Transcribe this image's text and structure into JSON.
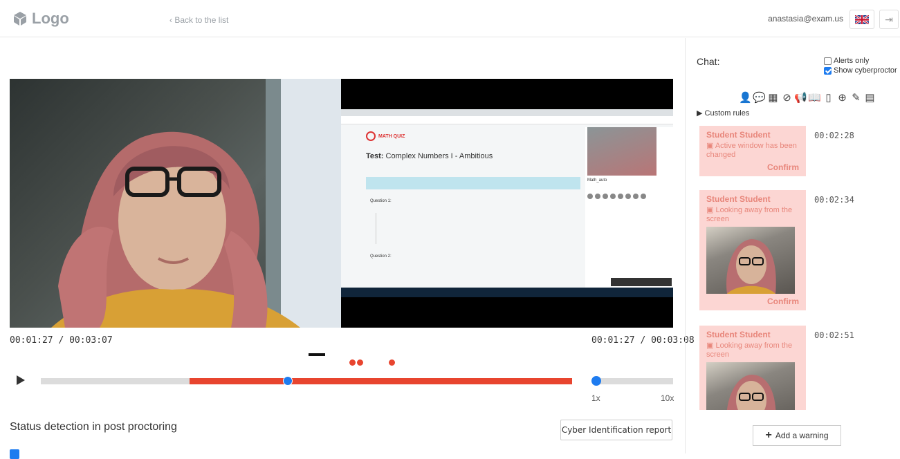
{
  "header": {
    "logo": "Logo",
    "back": "‹  Back to the list",
    "email": "anastasia@exam.us"
  },
  "player": {
    "time_left": "00:01:27 / 00:03:07",
    "time_right": "00:01:27 / 00:03:08",
    "progress": 0.465,
    "speed_min": "1x",
    "speed_max": "10x"
  },
  "screen_content": {
    "brand": "MATH QUIZ",
    "test_label": "Test:",
    "test_name": "Complex Numbers I - Ambitious",
    "q1": "Question 1:",
    "q2": "Question 2:",
    "math_auto": "Math_auto"
  },
  "status": {
    "title": "Status detection in post proctoring",
    "cyber_button": "Cyber Identification report"
  },
  "sidebar": {
    "chat_label": "Chat:",
    "alerts_only": "Alerts only",
    "show_cyberproctor": "Show cyberproctor",
    "custom_rules": "▶ Custom rules",
    "add_warning": "Add a warning",
    "events": [
      {
        "name": "Student Student",
        "message": "Active window has been changed",
        "time": "00:02:28",
        "confirm": "Confirm"
      },
      {
        "name": "Student Student",
        "message": "Looking away from the screen",
        "time": "00:02:34",
        "confirm": "Confirm"
      },
      {
        "name": "Student Student",
        "message": "Looking away from the screen",
        "time": "00:02:51"
      }
    ]
  },
  "colors": {
    "accent": "#1e7cf0",
    "alert": "#e8452f",
    "card_bg": "#fcd6d3"
  }
}
